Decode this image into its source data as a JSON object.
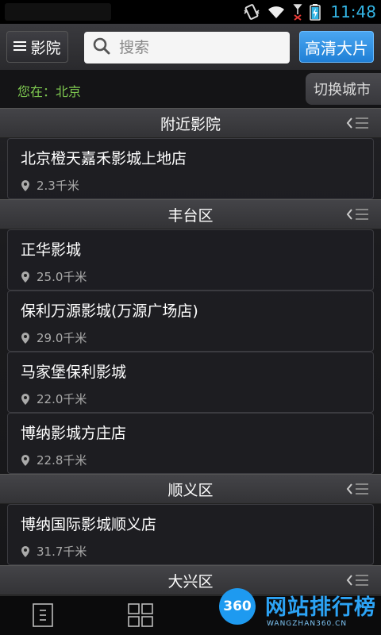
{
  "status": {
    "time": "11:48"
  },
  "topbar": {
    "cinema_label": "影院",
    "search_placeholder": "搜索",
    "hd_label": "高清大片"
  },
  "location": {
    "text": "您在：北京",
    "switch_label": "切换城市"
  },
  "sections": [
    {
      "title": "附近影院",
      "items": [
        {
          "name": "北京橙天嘉禾影城上地店",
          "distance": "2.3千米"
        }
      ]
    },
    {
      "title": "丰台区",
      "items": [
        {
          "name": "正华影城",
          "distance": "25.0千米"
        },
        {
          "name": "保利万源影城(万源广场店)",
          "distance": "29.0千米"
        },
        {
          "name": "马家堡保利影城",
          "distance": "22.0千米"
        },
        {
          "name": "博纳影城方庄店",
          "distance": "22.8千米"
        }
      ]
    },
    {
      "title": "顺义区",
      "items": [
        {
          "name": "博纳国际影城顺义店",
          "distance": "31.7千米"
        }
      ]
    },
    {
      "title": "大兴区",
      "items": []
    }
  ],
  "watermark": {
    "circle": "360",
    "title": "网站排行榜",
    "sub": "WANGZHAN360.CN"
  },
  "colors": {
    "accent_blue": "#33b5e5",
    "location_green": "#7ec850",
    "hd_button": "#1f7fd6"
  }
}
